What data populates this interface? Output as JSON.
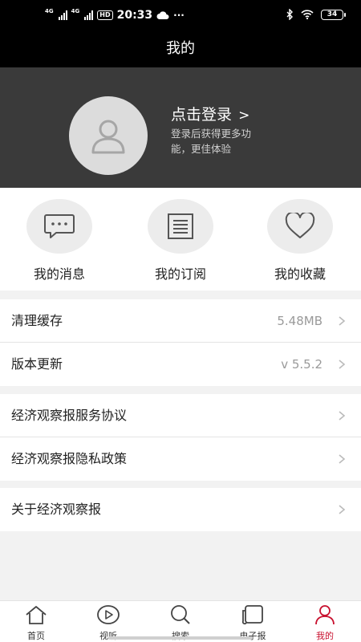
{
  "status_bar": {
    "network1": "4G",
    "network2": "4G",
    "hd": "HD",
    "time": "20:33",
    "dots": "···",
    "battery": "34"
  },
  "header": {
    "title": "我的"
  },
  "profile": {
    "login_label": "点击登录",
    "login_subtext": "登录后获得更多功能，更佳体验"
  },
  "quick_actions": [
    {
      "label": "我的消息",
      "icon": "message-icon"
    },
    {
      "label": "我的订阅",
      "icon": "subscription-list-icon"
    },
    {
      "label": "我的收藏",
      "icon": "heart-icon"
    }
  ],
  "settings": [
    {
      "label": "清理缓存",
      "value": "5.48MB"
    },
    {
      "label": "版本更新",
      "value": "v 5.5.2"
    },
    {
      "label": "经济观察报服务协议"
    },
    {
      "label": "经济观察报隐私政策"
    },
    {
      "label": "关于经济观察报"
    }
  ],
  "bottom_nav": [
    {
      "label": "首页",
      "icon": "home-icon"
    },
    {
      "label": "视听",
      "icon": "play-icon"
    },
    {
      "label": "搜索",
      "icon": "search-icon"
    },
    {
      "label": "电子报",
      "icon": "e-paper-icon"
    },
    {
      "label": "我的",
      "icon": "profile-icon",
      "active": true
    }
  ],
  "colors": {
    "accent": "#c8102e",
    "header_bg": "#000000",
    "profile_bg": "#3a3a3a"
  }
}
